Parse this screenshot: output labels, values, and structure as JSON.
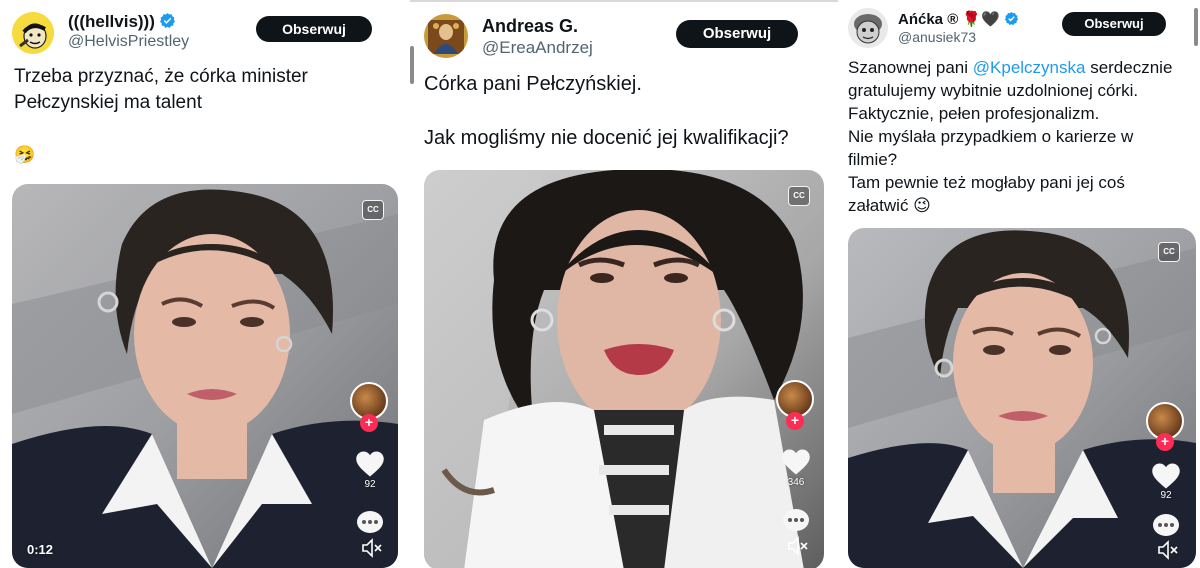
{
  "tweets": [
    {
      "display_name": "(((hellvis)))",
      "handle": "@HelvisPriestley",
      "verified": true,
      "follow_label": "Obserwuj",
      "text_lines": [
        "Trzeba przyznać, że córka minister",
        "Pełczynskiej ma talent",
        "",
        "🤧"
      ],
      "video": {
        "cc_label": "CC",
        "like_count": "92",
        "time": "0:12"
      }
    },
    {
      "display_name": "Andreas G.",
      "handle": "@EreaAndrzej",
      "verified": false,
      "follow_label": "Obserwuj",
      "text_lines": [
        "Córka pani Pełczyńskiej.",
        "",
        "Jak mogliśmy nie docenić jej kwalifikacji?"
      ],
      "video": {
        "cc_label": "CC",
        "like_count": "346"
      }
    },
    {
      "display_name": "Ańćka ® 🌹🖤",
      "handle": "@anusiek73",
      "verified": true,
      "follow_label": "Obserwuj",
      "text_prefix": "Szanownej pani ",
      "mention": "@Kpelczynska",
      "text_suffix": " serdecznie",
      "text_lines": [
        "gratulujemy wybitnie uzdolnionej córki.",
        "Faktycznie, pełen profesjonalizm.",
        "Nie myślała przypadkiem o karierze w",
        "filmie?",
        "Tam pewnie też mogłaby pani jej coś",
        "załatwić 😉"
      ],
      "video": {
        "cc_label": "CC",
        "like_count": "92"
      }
    }
  ],
  "colors": {
    "follow_bg": "#0f1419",
    "verified_blue": "#1d9bf0",
    "mention_blue": "#1d9bf0",
    "handle_gray": "#536471",
    "tiktok_red": "#fe2c55"
  },
  "icons": [
    "verified-badge-icon",
    "closed-captions-icon",
    "plus-icon",
    "heart-icon",
    "comment-dots-icon",
    "speaker-muted-icon"
  ]
}
